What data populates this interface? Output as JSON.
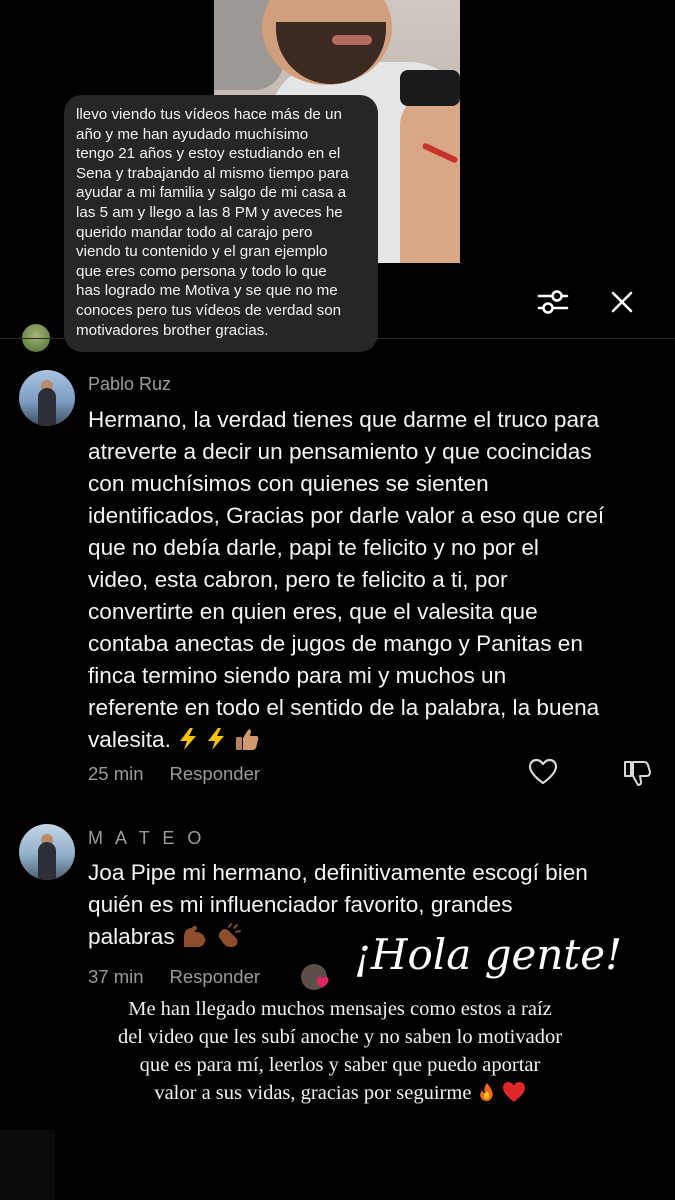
{
  "quoted_comment": {
    "lines": [
      "llevo viendo tus vídeos hace más de un",
      "año y me han ayudado muchísimo",
      "tengo 21 años y estoy estudiando en el",
      "Sena y trabajando al mismo tiempo para",
      "ayudar a mi familia y salgo de mi casa a",
      "las 5 am y llego a las 8 PM y aveces he",
      "querido mandar todo al carajo pero",
      "viendo tu contenido y el gran ejemplo",
      "que eres como persona y todo lo que",
      "has logrado me Motiva y se que no me",
      "conoces pero tus vídeos de verdad son",
      "motivadores brother gracias."
    ]
  },
  "toolbar": {
    "filter_icon": "sliders-icon",
    "close_icon": "close-icon"
  },
  "comments": [
    {
      "username": "Pablo Ruz",
      "lines": [
        "Hermano, la verdad tienes que darme el truco para",
        "atreverte a decir un pensamiento y que cocincidas",
        "con muchísimos con quienes se sienten",
        "identificados, Gracias por darle valor a eso que creí",
        "que no debía darle, papi te felicito y no por el",
        "video, esta cabron, pero te felicito a ti, por",
        "convertirte en quien eres, que el valesita que",
        "contaba anectas de jugos de mango y Panitas en",
        "finca termino siendo para mi y muchos un",
        "referente en todo el sentido de la palabra, la buena",
        "valesita."
      ],
      "emojis": [
        "lightning-emoji",
        "lightning-emoji",
        "thumbs-up-emoji"
      ],
      "time": "25 min",
      "reply_label": "Responder"
    },
    {
      "username": "M A T E O",
      "lines": [
        "Joa Pipe mi hermano, definitivamente escogí bien",
        "quién es mi influenciador favorito, grandes",
        "palabras"
      ],
      "emojis": [
        "flexed-biceps-emoji",
        "clapping-hands-emoji"
      ],
      "time": "37 min",
      "reply_label": "Responder"
    }
  ],
  "story_overlay": {
    "headline": "¡Hola gente!",
    "caption_lines": [
      "Me han llegado muchos mensajes como estos a raíz",
      "del video que les subí anoche y no saben lo motivador",
      "que es para mí, leerlos y saber que puedo aportar",
      "valor a sus vidas, gracias por seguirme"
    ],
    "caption_emojis": [
      "fire-emoji",
      "red-heart-emoji"
    ]
  },
  "colors": {
    "background": "#000000",
    "bubble": "#262626",
    "muted_text": "#9a9a9a",
    "heart_red": "#e0245e"
  }
}
